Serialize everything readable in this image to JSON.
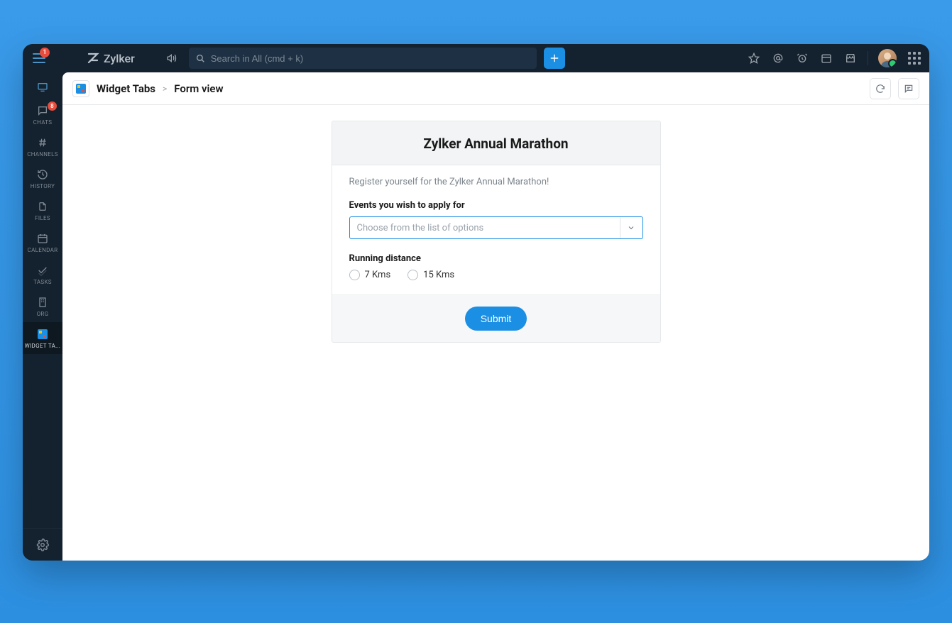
{
  "header": {
    "brand": "Zylker",
    "hamburger_badge": "1",
    "search_placeholder": "Search in All (cmd + k)"
  },
  "sidebar": {
    "items": [
      {
        "label": "",
        "icon": "monitor"
      },
      {
        "label": "CHATS",
        "icon": "chat",
        "badge": "8"
      },
      {
        "label": "CHANNELS",
        "icon": "hash"
      },
      {
        "label": "HISTORY",
        "icon": "history"
      },
      {
        "label": "FILES",
        "icon": "file"
      },
      {
        "label": "CALENDAR",
        "icon": "calendar"
      },
      {
        "label": "TASKS",
        "icon": "check"
      },
      {
        "label": "ORG",
        "icon": "org"
      },
      {
        "label": "WIDGET TA...",
        "icon": "widget",
        "active": true
      }
    ]
  },
  "breadcrumb": {
    "title": "Widget Tabs",
    "sep": ">",
    "current": "Form view"
  },
  "form": {
    "title": "Zylker Annual Marathon",
    "description": "Register yourself for the Zylker Annual Marathon!",
    "events_label": "Events you wish to apply for",
    "events_placeholder": "Choose from the list of options",
    "distance_label": "Running distance",
    "distance_options": [
      "7 Kms",
      "15 Kms"
    ],
    "submit_label": "Submit"
  }
}
